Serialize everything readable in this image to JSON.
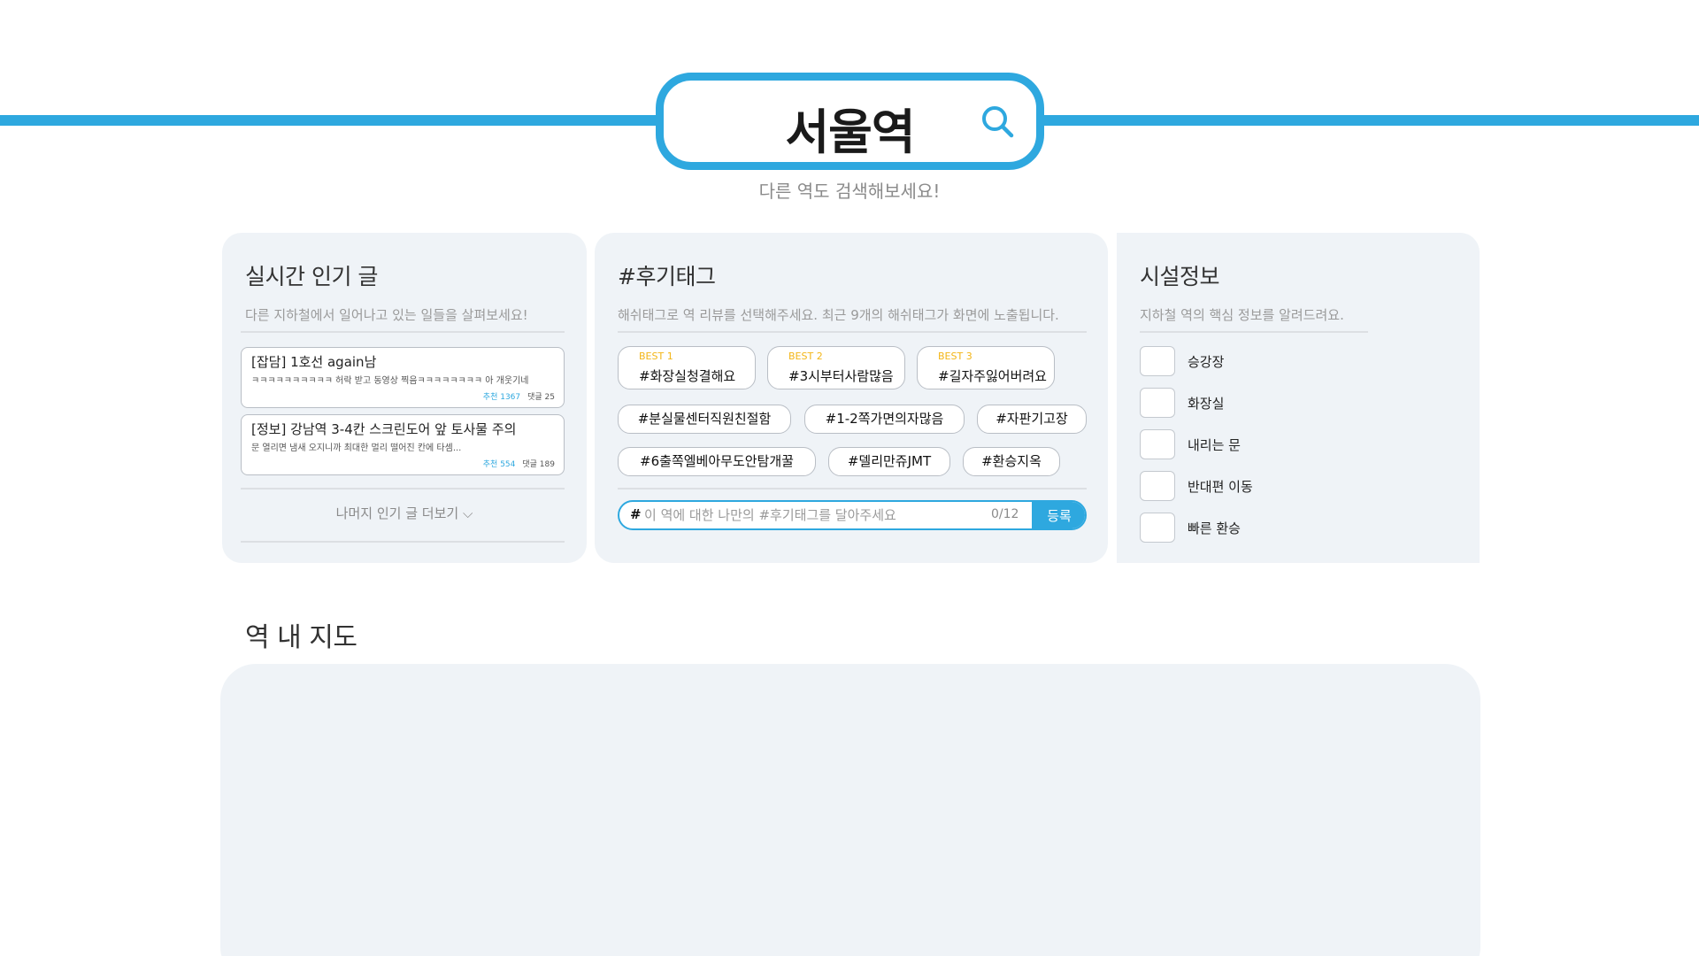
{
  "search": {
    "station": "서울역",
    "hint": "다른 역도 검색해보세요!"
  },
  "popular": {
    "title": "실시간 인기 글",
    "subtitle": "다른 지하철에서 일어나고 있는 일들을 살펴보세요!",
    "posts": [
      {
        "title": "[잡담] 1호선 again남",
        "body": "ㅋㅋㅋㅋㅋㅋㅋㅋㅋㅋ 허락 받고 동영상 찍음ㅋㅋㅋㅋㅋㅋㅋㅋ 아 개웃기네",
        "rec_label": "추천 1367",
        "comment_label": "댓글 25"
      },
      {
        "title": "[정보] 강남역 3-4칸 스크린도어 앞 토사물 주의",
        "body": "문 열리면 냄새 오지니까 최대한 멀리 떨어진 칸에 타셈...",
        "rec_label": "추천 554",
        "comment_label": "댓글 189"
      }
    ],
    "more_label": "나머지 인기 글 더보기 ⌵"
  },
  "hashtags": {
    "title": "#후기태그",
    "subtitle": "해쉬태그로 역 리뷰를 선택해주세요. 최근 9개의 해쉬태그가 화면에 노출됩니다.",
    "best": [
      {
        "label": "BEST 1",
        "tag": "#화장실청결해요"
      },
      {
        "label": "BEST 2",
        "tag": "#3시부터사람많음"
      },
      {
        "label": "BEST 3",
        "tag": "#길자주잃어버려요"
      }
    ],
    "tags": [
      "#분실물센터직원친절함",
      "#1-2쪽가면의자많음",
      "#자판기고장",
      "#6출쪽엘베아무도안탐개꿀",
      "#델리만쥬JMT",
      "#환승지옥"
    ],
    "input": {
      "hash": "#",
      "placeholder": "이 역에 대한 나만의 #후기태그를 달아주세요",
      "counter": "0/12",
      "submit_label": "등록"
    }
  },
  "facilities": {
    "title": "시설정보",
    "subtitle": "지하철 역의 핵심 정보를 알려드려요.",
    "items": [
      "승강장",
      "화장실",
      "내리는 문",
      "반대편 이동",
      "빠른 환승"
    ]
  },
  "map": {
    "title": "역 내 지도"
  },
  "colors": {
    "accent": "#2ea8df",
    "best": "#f3b516",
    "card": "#eff3f7"
  }
}
